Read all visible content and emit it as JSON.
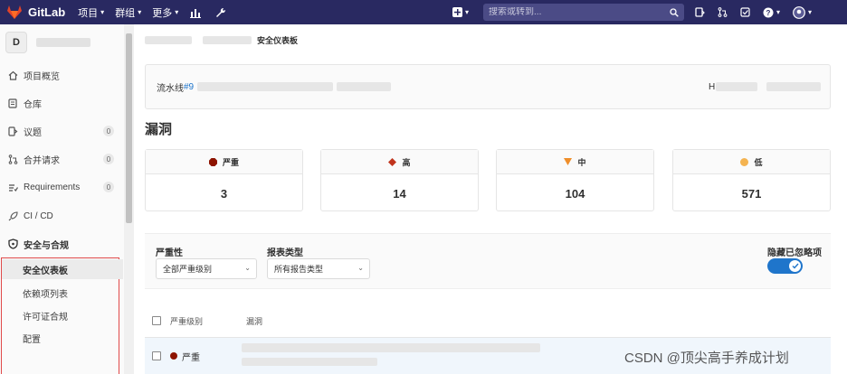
{
  "navbar": {
    "brand": "GitLab",
    "menu": [
      {
        "label": "项目",
        "icon": "chevron-down-icon"
      },
      {
        "label": "群组",
        "icon": "chevron-down-icon"
      },
      {
        "label": "更多",
        "icon": "chevron-down-icon"
      }
    ],
    "search_placeholder": "搜索或转到...",
    "brand_color": "#292961"
  },
  "sidebar": {
    "avatar_letter": "D",
    "items": [
      {
        "label": "项目概览",
        "icon": "home-icon",
        "badge": ""
      },
      {
        "label": "仓库",
        "icon": "repository-icon",
        "badge": ""
      },
      {
        "label": "议题",
        "icon": "issues-icon",
        "badge": "0"
      },
      {
        "label": "合并请求",
        "icon": "merge-request-icon",
        "badge": "0"
      },
      {
        "label": "Requirements",
        "icon": "requirements-icon",
        "badge": "0"
      },
      {
        "label": "CI / CD",
        "icon": "rocket-icon",
        "badge": ""
      }
    ],
    "security": {
      "title": "安全与合规",
      "icon": "shield-icon",
      "subitems": [
        {
          "label": "安全仪表板",
          "active": true
        },
        {
          "label": "依赖项列表",
          "active": false
        },
        {
          "label": "许可证合规",
          "active": false
        },
        {
          "label": "配置",
          "active": false
        }
      ]
    }
  },
  "breadcrumb": {
    "current": "安全仪表板"
  },
  "pipeline": {
    "prefix": "流水线",
    "link": "#9",
    "right_initial": "H"
  },
  "vulnerabilities": {
    "title": "漏洞",
    "cards": [
      {
        "label": "严重",
        "count": "3",
        "color": "#8d1300",
        "icon": "severity-critical-icon"
      },
      {
        "label": "高",
        "count": "14",
        "color": "#c0341d",
        "icon": "severity-high-icon"
      },
      {
        "label": "中",
        "count": "104",
        "color": "#ef8e2a",
        "icon": "severity-medium-icon"
      },
      {
        "label": "低",
        "count": "571",
        "color": "#f4b350",
        "icon": "severity-low-icon"
      }
    ]
  },
  "filters": {
    "severity": {
      "label": "严重性",
      "value": "全部严重级别"
    },
    "report_type": {
      "label": "报表类型",
      "value": "所有报告类型"
    },
    "hide_dismissed": {
      "label": "隐藏已忽略项",
      "on": true
    }
  },
  "table": {
    "headers": [
      "严重级别",
      "漏洞"
    ],
    "rows": [
      {
        "severity": "严重",
        "color": "#8d1300"
      }
    ]
  },
  "watermark": "CSDN @顶尖高手养成计划"
}
